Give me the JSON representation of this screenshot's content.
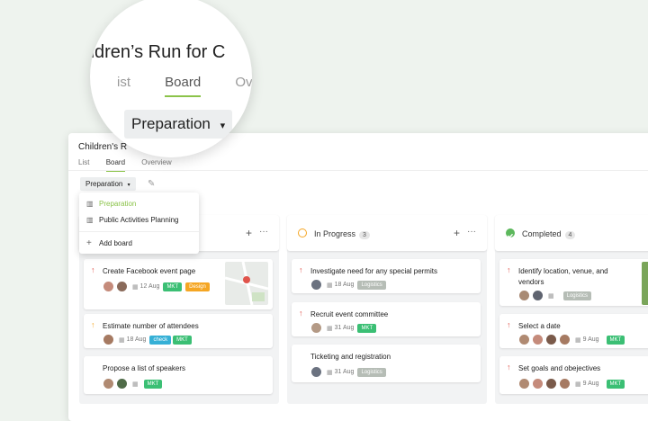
{
  "magnifier": {
    "title": "hildren’s Run for C",
    "tabs": [
      "ist",
      "Board",
      "Ove"
    ],
    "view_select": "Preparation"
  },
  "app": {
    "title": "Children's R",
    "tabs": [
      "List",
      "Board",
      "Overview"
    ],
    "view_select": "Preparation"
  },
  "dropdown": {
    "items": [
      "Preparation",
      "Public Activities Planning"
    ],
    "add": "Add board"
  },
  "columns": [
    {
      "title": "",
      "cards": [
        {
          "title": "Create Facebook event page",
          "date": "12 Aug",
          "tags": [
            "MKT",
            "Design"
          ],
          "priority": "high"
        },
        {
          "title": "Estimate number of attendees",
          "date": "18 Aug",
          "tags": [
            "check",
            "MKT"
          ],
          "priority": "medium"
        },
        {
          "title": "Propose a list of speakers",
          "date": "",
          "tags": [
            "MKT"
          ],
          "priority": "none"
        }
      ]
    },
    {
      "title": "In Progress",
      "count": "3",
      "cards": [
        {
          "title": "Investigate need for any special permits",
          "date": "18 Aug",
          "tags": [
            "Logistics"
          ],
          "priority": "high"
        },
        {
          "title": "Recruit event committee",
          "date": "31 Aug",
          "tags": [
            "MKT"
          ],
          "priority": "high"
        },
        {
          "title": "Ticketing and registration",
          "date": "31 Aug",
          "tags": [
            "Logistics"
          ],
          "priority": "none"
        }
      ]
    },
    {
      "title": "Completed",
      "count": "4",
      "cards": [
        {
          "title": "Identify location, venue, and",
          "title2": "vendors",
          "date": "",
          "tags": [
            "Logistics"
          ],
          "priority": "high"
        },
        {
          "title": "Select a date",
          "date": "9 Aug",
          "tags": [
            "MKT"
          ],
          "priority": "high"
        },
        {
          "title": "Set goals and obejectives",
          "date": "9 Aug",
          "tags": [
            "MKT"
          ],
          "priority": "high"
        }
      ]
    }
  ],
  "icons": {
    "add": "+",
    "more": "···",
    "caret": "▾",
    "arrow_up": "↑",
    "calendar": "▦",
    "edit": "✎",
    "board": "▥"
  },
  "colors": {
    "accent_green": "#8bc34a",
    "in_progress": "#f5a623",
    "completed": "#5cb85c",
    "priority_high": "#e0544b",
    "priority_medium": "#f5a623"
  }
}
